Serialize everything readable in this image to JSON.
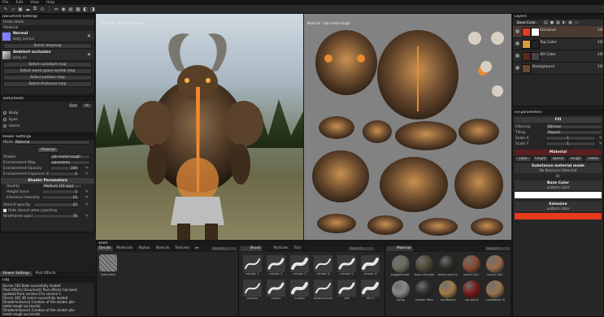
{
  "menu": [
    "File",
    "Edit",
    "View",
    "Help"
  ],
  "document_settings": {
    "title": "Document Settings",
    "undo_stack": "Undo stack",
    "material": "Material",
    "normal_label": "Normal",
    "normal_file": "body_normal",
    "select_dropmap": "Select dropmap",
    "ao_label": "Ambient occlusion",
    "ao_file": "body_ao",
    "buttons": [
      "Select curvature map",
      "Select world space normal map",
      "Select position map",
      "Select thickness map"
    ]
  },
  "texture_sets": {
    "title": "TextureSets",
    "btn_solo": "Solo",
    "btn_all": "All",
    "items": [
      "Body",
      "Eyes",
      "Horns"
    ]
  },
  "viewer_settings": {
    "title": "Viewer Settings",
    "mode_label": "Mode",
    "mode_value": "Material",
    "tab_material": "Material",
    "shader_label": "Shader",
    "shader_value": "pbr-metal-rough",
    "envmap_label": "Environment Map",
    "envmap_value": "panorama",
    "envop_label": "Environment Opacity",
    "envop_value": "100",
    "envexp_label": "Environment Exposure (EV)",
    "envexp_value": "1",
    "shader_params": "Shader Parameters",
    "quality_label": "Quality",
    "quality_value": "Medium (16 spp)",
    "height_label": "Height force",
    "height_value": "1",
    "emissive_label": "Emissive Intensity",
    "emissive_value": "15",
    "stencil_label": "Stencil opacity",
    "stencil_value": "25",
    "hide_stencil": "Hide stencil when painting",
    "wireframe_label": "Wireframe opacity",
    "wireframe_value": "70"
  },
  "log": {
    "tab_viewer": "Viewer Settings",
    "tab_post": "Post Effects",
    "title": "Log",
    "lines": [
      "[Scene 3D] Bake sucessfully loaded",
      "[Post Effects Document] Post effects has been",
      "updated from version 0 to version 1.",
      "[Scene 3D] 3D scene sucessfully loaded",
      "[ShaderInstance] Creation of the shader pbr-",
      "metal-rough successful",
      "[ShaderInstance] Creation of the shader pbr-",
      "metal-rough successful"
    ]
  },
  "viewport3d": {
    "label": "Material - pbr-metal-rough"
  },
  "viewport2d": {
    "label": "Material - pbr-metal-rough"
  },
  "layers": {
    "title": "Layers",
    "blend": "Base Color",
    "items": [
      {
        "name": "Emissive",
        "value": "100"
      },
      {
        "name": "Top Color",
        "value": "100"
      },
      {
        "name": "AO Color",
        "value": "100"
      },
      {
        "name": "Background",
        "value": "100"
      }
    ]
  },
  "fill": {
    "title": "Fill parameters",
    "section": "Fill",
    "filtering_label": "Filtering",
    "filtering_value": "Bilinear",
    "tiling_label": "Tiling",
    "tiling_value": "Repeat",
    "scalex_label": "Scale X",
    "scalex_value": "1",
    "scaley_label": "Scale Y",
    "scaley_value": "1",
    "material_section": "Material",
    "chips": [
      "color",
      "height",
      "specul",
      "rough",
      "metal"
    ],
    "substance_mode": "Substance material mode",
    "no_resource": "No Resource Selected",
    "or": "Or",
    "basecolor_title": "Base Color",
    "basecolor_sub": "uniform color",
    "emissive_title": "Emissive",
    "emissive_sub": "uniform color",
    "emissive_color": "#e83a1c"
  },
  "shelf": {
    "title": "Shelf",
    "tabs": [
      "Decals",
      "Materials",
      "Alphas",
      "Stencils",
      "Textures"
    ],
    "search": "Search...",
    "decal_label": "Gree fleki",
    "brush_tab": "Brush",
    "particles_tab": "Particles",
    "tool_tab": "Tool",
    "brushes": [
      "artistic 1",
      "artistic 2",
      "artistic 3",
      "artistic 4",
      "artistic 5",
      "artistic 6",
      "cellular",
      "cracks",
      "crystal",
      "default brush",
      "dirt",
      "dirt 2"
    ],
    "material_tab": "Material",
    "materials": [
      {
        "name": "bagged wall...",
        "color": "#6d6a5e"
      },
      {
        "name": "bark old green",
        "color": "#4c4a34"
      },
      {
        "name": "black olive bark",
        "color": "#2a2a24"
      },
      {
        "name": "bricks 001",
        "color": "#8a4a32"
      },
      {
        "name": "bricks 002",
        "color": "#9a6a4a"
      },
      {
        "name": "bump",
        "color": "#8a8a8a"
      },
      {
        "name": "carbon fiber",
        "color": "#2d2d2d"
      },
      {
        "name": "cardboard",
        "color": "#a47a4a"
      },
      {
        "name": "car paint",
        "color": "#7a1a1a"
      },
      {
        "name": "Cardboard 002",
        "color": "#9a744e"
      }
    ]
  },
  "colors": {
    "accent": "#e85a1a",
    "emissive": "#e83a1c"
  }
}
